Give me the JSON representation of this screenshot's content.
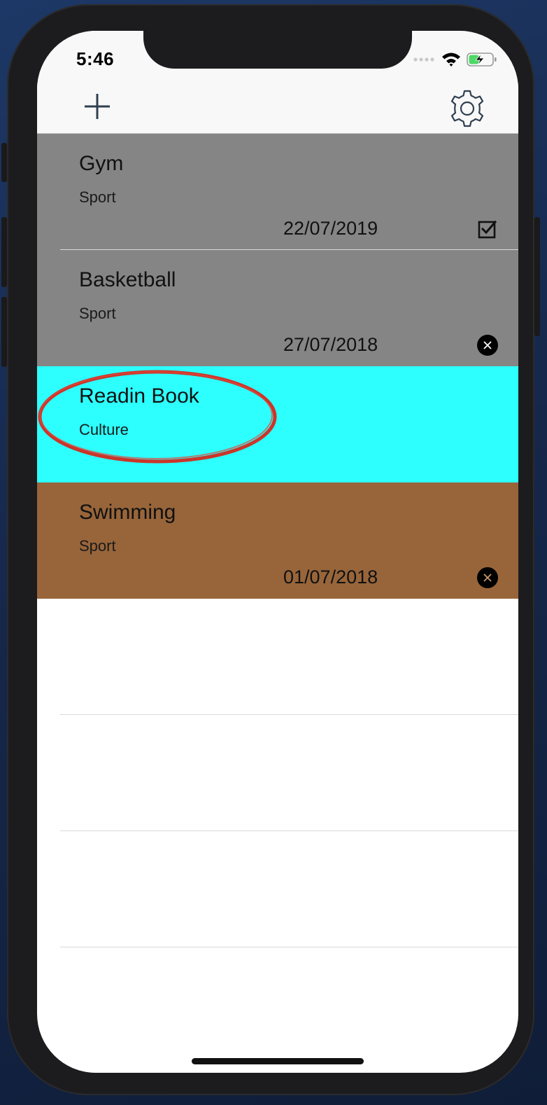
{
  "status_bar": {
    "time": "5:46"
  },
  "toolbar": {
    "add_icon": "plus-icon",
    "settings_icon": "gear-icon"
  },
  "activities": [
    {
      "title": "Gym",
      "category": "Sport",
      "date": "22/07/2019",
      "status": "checked",
      "status_icon": "checkbox-checked-icon",
      "background": "#858585"
    },
    {
      "title": "Basketball",
      "category": "Sport",
      "date": "27/07/2018",
      "status": "cancelled",
      "status_icon": "close-circle-icon",
      "background": "#858585"
    },
    {
      "title": "Readin Book",
      "category": "Culture",
      "date": "",
      "status": "none",
      "status_icon": "",
      "background": "#2dfffe"
    },
    {
      "title": "Swimming",
      "category": "Sport",
      "date": "01/07/2018",
      "status": "cancelled",
      "status_icon": "close-circle-icon",
      "background": "#98653a"
    }
  ],
  "colors": {
    "annotation": "#d42a1e",
    "navbar": "#f8f8f8",
    "icon_tint": "#2f3f4f"
  }
}
